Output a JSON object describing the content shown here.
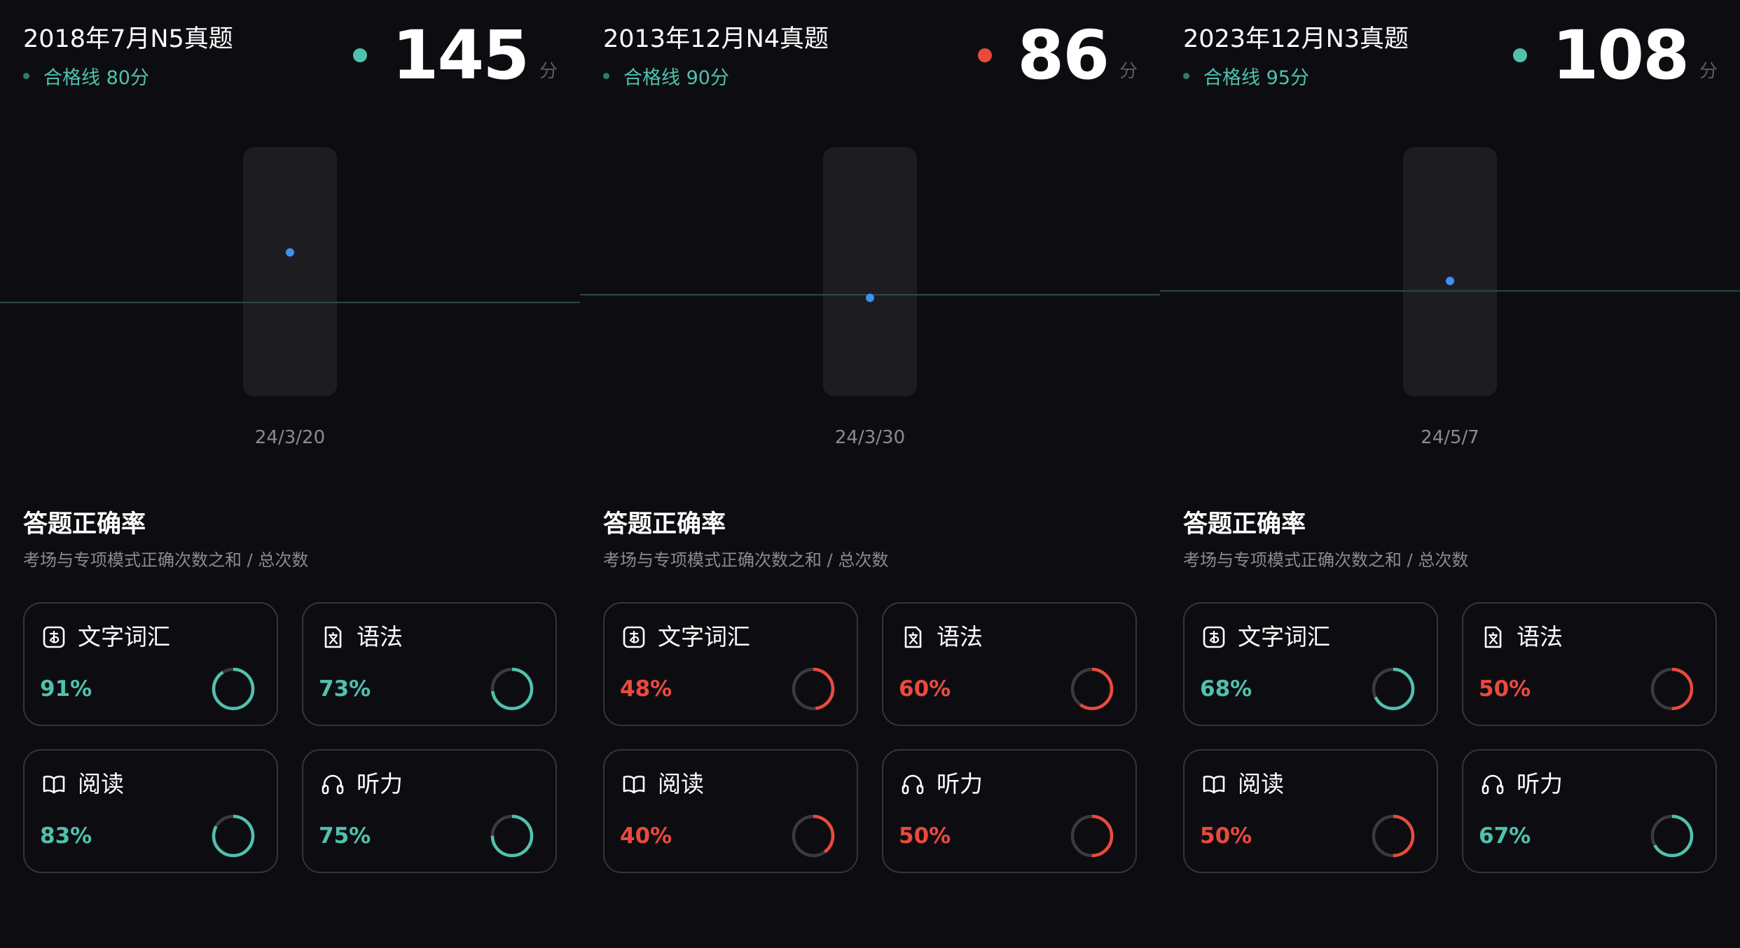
{
  "colors": {
    "pass": "#4fc2ad",
    "fail": "#ea4a3e",
    "point": "#3f8ef0",
    "ring_track": "#3a3a40",
    "pill": "#1d1d21",
    "line": "#2c4a44"
  },
  "panels": [
    {
      "title": "2018年7月N5真题",
      "passline": "合格线 80分",
      "score": "145",
      "score_unit": "分",
      "status": "pass",
      "section_title": "答题正确率",
      "section_sub": "考场与专项模式正确次数之和 / 总次数",
      "categories": [
        {
          "icon": "kana-icon",
          "label": "文字词汇",
          "pct_text": "91%",
          "pct": 91,
          "status": "pass"
        },
        {
          "icon": "grammar-icon",
          "label": "语法",
          "pct_text": "73%",
          "pct": 73,
          "status": "pass"
        },
        {
          "icon": "book-icon",
          "label": "阅读",
          "pct_text": "83%",
          "pct": 83,
          "status": "pass"
        },
        {
          "icon": "headphones-icon",
          "label": "听力",
          "pct_text": "75%",
          "pct": 75,
          "status": "pass"
        }
      ]
    },
    {
      "title": "2013年12月N4真题",
      "passline": "合格线 90分",
      "score": "86",
      "score_unit": "分",
      "status": "fail",
      "section_title": "答题正确率",
      "section_sub": "考场与专项模式正确次数之和 / 总次数",
      "categories": [
        {
          "icon": "kana-icon",
          "label": "文字词汇",
          "pct_text": "48%",
          "pct": 48,
          "status": "fail"
        },
        {
          "icon": "grammar-icon",
          "label": "语法",
          "pct_text": "60%",
          "pct": 60,
          "status": "fail"
        },
        {
          "icon": "book-icon",
          "label": "阅读",
          "pct_text": "40%",
          "pct": 40,
          "status": "fail"
        },
        {
          "icon": "headphones-icon",
          "label": "听力",
          "pct_text": "50%",
          "pct": 50,
          "status": "fail"
        }
      ]
    },
    {
      "title": "2023年12月N3真题",
      "passline": "合格线 95分",
      "score": "108",
      "score_unit": "分",
      "status": "pass",
      "section_title": "答题正确率",
      "section_sub": "考场与专项模式正确次数之和 / 总次数",
      "categories": [
        {
          "icon": "kana-icon",
          "label": "文字词汇",
          "pct_text": "68%",
          "pct": 68,
          "status": "pass"
        },
        {
          "icon": "grammar-icon",
          "label": "语法",
          "pct_text": "50%",
          "pct": 50,
          "status": "fail"
        },
        {
          "icon": "book-icon",
          "label": "阅读",
          "pct_text": "50%",
          "pct": 50,
          "status": "fail"
        },
        {
          "icon": "headphones-icon",
          "label": "听力",
          "pct_text": "67%",
          "pct": 67,
          "status": "pass"
        }
      ]
    }
  ],
  "chart_data": [
    {
      "type": "scatter",
      "categories": [
        "24/3/20"
      ],
      "values": [
        145
      ],
      "reference_line": 80
    },
    {
      "type": "scatter",
      "categories": [
        "24/3/30"
      ],
      "values": [
        86
      ],
      "reference_line": 90
    },
    {
      "type": "scatter",
      "categories": [
        "24/5/7"
      ],
      "values": [
        108
      ],
      "reference_line": 95
    }
  ]
}
